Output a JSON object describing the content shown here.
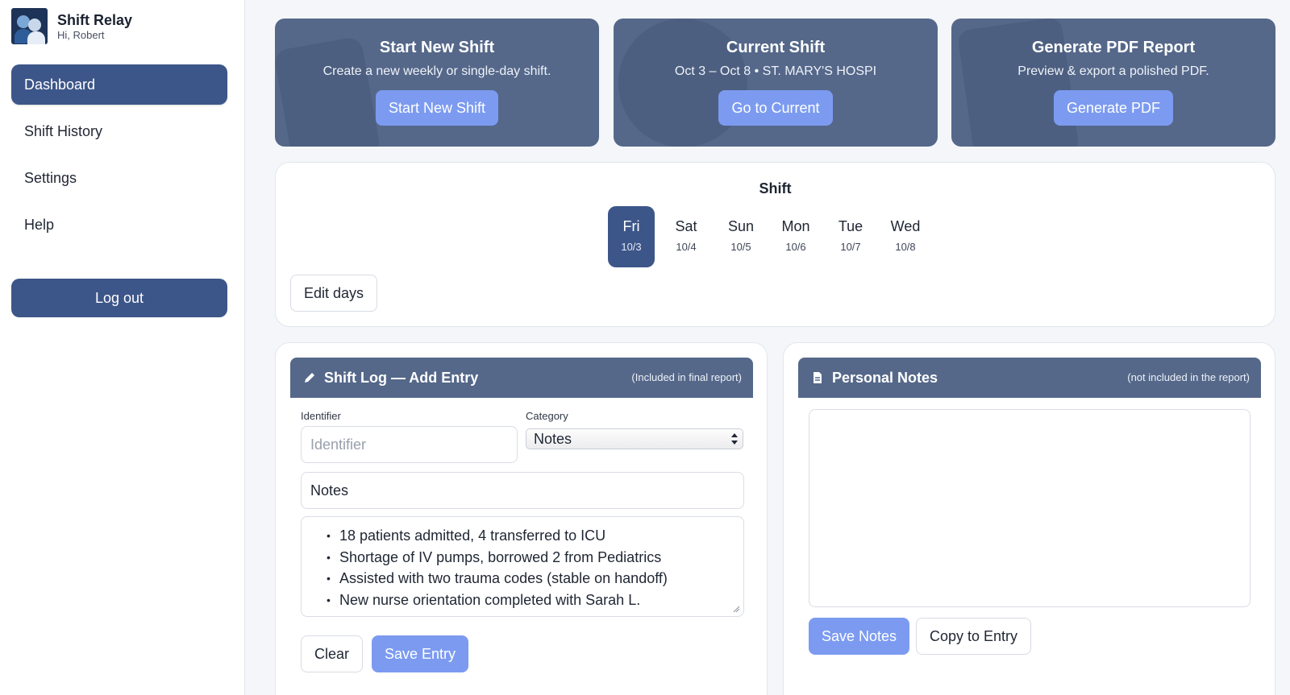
{
  "app": {
    "title": "Shift Relay",
    "greeting": "Hi, Robert"
  },
  "sidebar": {
    "items": [
      {
        "label": "Dashboard",
        "active": true
      },
      {
        "label": "Shift History"
      },
      {
        "label": "Settings"
      },
      {
        "label": "Help"
      }
    ],
    "logout_label": "Log out"
  },
  "cards": [
    {
      "title": "Start New Shift",
      "desc": "Create a new weekly or single-day shift.",
      "button": "Start New Shift"
    },
    {
      "title": "Current Shift",
      "desc": "Oct 3 – Oct 8 • ST. MARY'S HOSPI",
      "button": "Go to Current"
    },
    {
      "title": "Generate PDF Report",
      "desc": "Preview & export a polished PDF.",
      "button": "Generate PDF"
    }
  ],
  "shift": {
    "title": "Shift",
    "days": [
      {
        "name": "Fri",
        "date": "10/3",
        "active": true
      },
      {
        "name": "Sat",
        "date": "10/4"
      },
      {
        "name": "Sun",
        "date": "10/5"
      },
      {
        "name": "Mon",
        "date": "10/6"
      },
      {
        "name": "Tue",
        "date": "10/7"
      },
      {
        "name": "Wed",
        "date": "10/8"
      }
    ],
    "edit_days_label": "Edit days"
  },
  "log": {
    "title": "Shift Log — Add Entry",
    "subtitle": "(Included in final report)",
    "identifier_label": "Identifier",
    "identifier_placeholder": "Identifier",
    "category_label": "Category",
    "category_value": "Notes",
    "title_value": "Notes",
    "bullets": [
      "18 patients admitted, 4 transferred to ICU",
      "Shortage of IV pumps, borrowed 2 from Pediatrics",
      "Assisted with two trauma codes (stable on handoff)",
      "New nurse orientation completed with Sarah L."
    ],
    "clear_label": "Clear",
    "save_label": "Save Entry"
  },
  "notes": {
    "title": "Personal Notes",
    "subtitle": "(not included in the report)",
    "save_label": "Save Notes",
    "copy_label": "Copy to Entry"
  },
  "colors": {
    "accent": "#3d5689",
    "header": "#55688a",
    "button": "#7c9bf0"
  }
}
